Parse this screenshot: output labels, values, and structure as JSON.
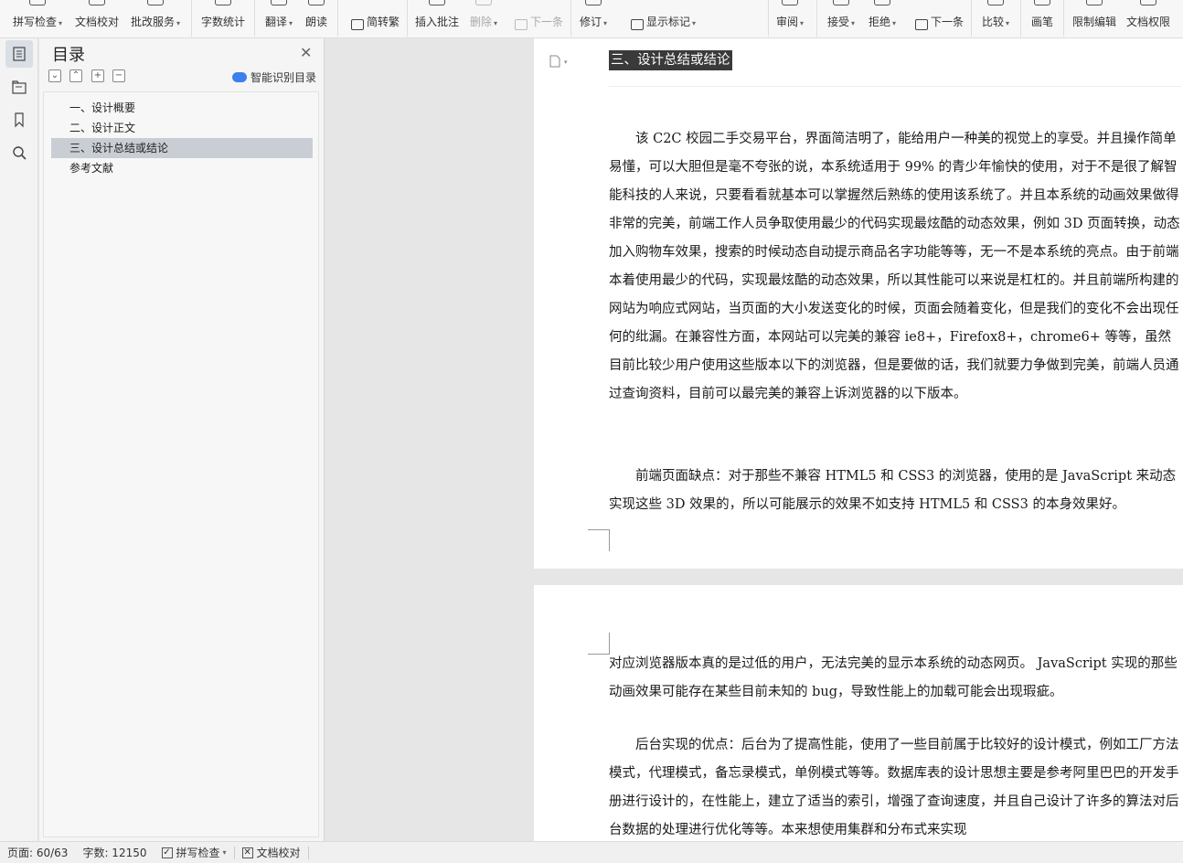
{
  "ribbon": {
    "buttons": [
      {
        "label": "拼写检查",
        "caret": true
      },
      {
        "label": "文档校对",
        "caret": false
      },
      {
        "label": "批改服务",
        "caret": true
      },
      {
        "label": "字数统计",
        "caret": false
      },
      {
        "label": "翻译",
        "caret": true
      },
      {
        "label": "朗读",
        "caret": false
      },
      {
        "label": "简转繁",
        "caret": false
      },
      {
        "label": "插入批注",
        "caret": false
      },
      {
        "label": "删除",
        "caret": true
      },
      {
        "label": "下一条",
        "caret": false
      },
      {
        "label": "修订",
        "caret": true
      },
      {
        "label": "显示标记",
        "caret": true
      },
      {
        "label": "审阅",
        "caret": true
      },
      {
        "label": "接受",
        "caret": true
      },
      {
        "label": "拒绝",
        "caret": true
      },
      {
        "label": "下一条",
        "caret": false
      },
      {
        "label": "比较",
        "caret": true
      },
      {
        "label": "画笔",
        "caret": false
      },
      {
        "label": "限制编辑",
        "caret": false
      },
      {
        "label": "文档权限",
        "caret": false
      }
    ]
  },
  "toc": {
    "title": "目录",
    "smart_label": "智能识别目录",
    "items": [
      {
        "label": "一、设计概要"
      },
      {
        "label": "二、设计正文"
      },
      {
        "label": "三、设计总结或结论"
      },
      {
        "label": "参考文献"
      }
    ]
  },
  "document": {
    "heading": "三、设计总结或结论",
    "page1_paragraphs": [
      "该 C2C 校园二手交易平台，界面简洁明了，能给用户一种美的视觉上的享受。并且操作简单易懂，可以大胆但是毫不夸张的说，本系统适用于 99% 的青少年愉快的使用，对于不是很了解智能科技的人来说，只要看看就基本可以掌握然后熟练的使用该系统了。并且本系统的动画效果做得非常的完美，前端工作人员争取使用最少的代码实现最炫酷的动态效果，例如 3D 页面转换，动态加入购物车效果，搜索的时候动态自动提示商品名字功能等等，无一不是本系统的亮点。由于前端本着使用最少的代码，实现最炫酷的动态效果，所以其性能可以来说是杠杠的。并且前端所构建的网站为响应式网站，当页面的大小发送变化的时候，页面会随着变化，但是我们的变化不会出现任何的纰漏。在兼容性方面，本网站可以完美的兼容 ie8+，Firefox8+，chrome6+ 等等，虽然目前比较少用户使用这些版本以下的浏览器，但是要做的话，我们就要力争做到完美，前端人员通过查询资料，目前可以最完美的兼容上诉浏览器的以下版本。",
      "前端页面缺点：对于那些不兼容 HTML5 和 CSS3 的浏览器，使用的是 JavaScript 来动态实现这些 3D 效果的，所以可能展示的效果不如支持 HTML5 和 CSS3 的本身效果好。"
    ],
    "page2_paragraphs": [
      "对应浏览器版本真的是过低的用户，无法完美的显示本系统的动态网页。 JavaScript 实现的那些动画效果可能存在某些目前未知的 bug，导致性能上的加载可能会出现瑕疵。",
      "后台实现的优点：后台为了提高性能，使用了一些目前属于比较好的设计模式，例如工厂方法模式，代理模式，备忘录模式，单例模式等等。数据库表的设计思想主要是参考阿里巴巴的开发手册进行设计的，在性能上，建立了适当的索引，增强了查询速度，并且自己设计了许多的算法对后台数据的处理进行优化等等。本来想使用集群和分布式来实现"
    ]
  },
  "status": {
    "page": "页面: 60/63",
    "words": "字数: 12150",
    "spell": "拼写检查",
    "proof": "文档校对"
  },
  "colors": {
    "accent": "#3d7ff0",
    "heading_bg": "#3a3a3a",
    "toc_active": "#c9ced5"
  }
}
